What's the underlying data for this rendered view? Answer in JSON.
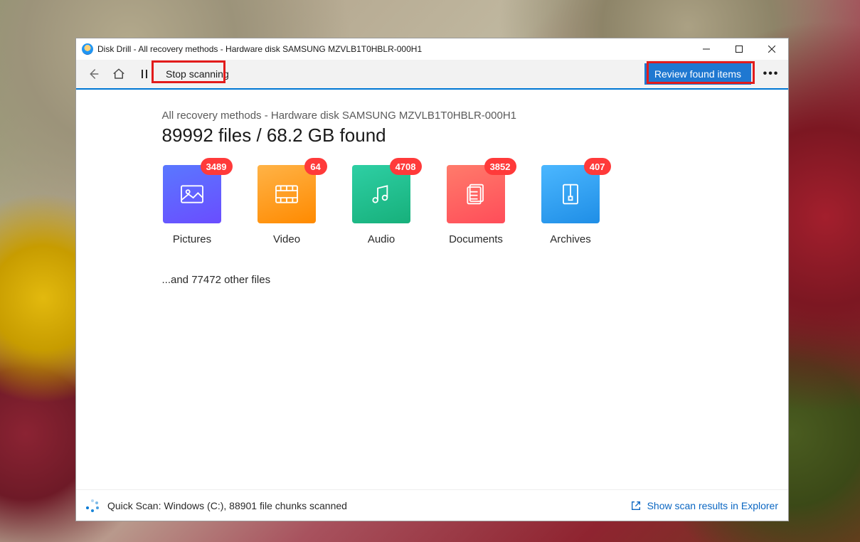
{
  "window": {
    "title": "Disk Drill - All recovery methods - Hardware disk SAMSUNG MZVLB1T0HBLR-000H1"
  },
  "toolbar": {
    "stop_label": "Stop scanning",
    "review_label": "Review found items"
  },
  "content": {
    "breadcrumb": "All recovery methods - Hardware disk SAMSUNG MZVLB1T0HBLR-000H1",
    "summary": "89992 files / 68.2 GB found",
    "other_files": "...and 77472 other files"
  },
  "categories": [
    {
      "key": "pictures",
      "label": "Pictures",
      "count": "3489"
    },
    {
      "key": "video",
      "label": "Video",
      "count": "64"
    },
    {
      "key": "audio",
      "label": "Audio",
      "count": "4708"
    },
    {
      "key": "documents",
      "label": "Documents",
      "count": "3852"
    },
    {
      "key": "archives",
      "label": "Archives",
      "count": "407"
    }
  ],
  "status": {
    "text": "Quick Scan: Windows (C:), 88901 file chunks scanned",
    "link": "Show scan results in Explorer"
  }
}
